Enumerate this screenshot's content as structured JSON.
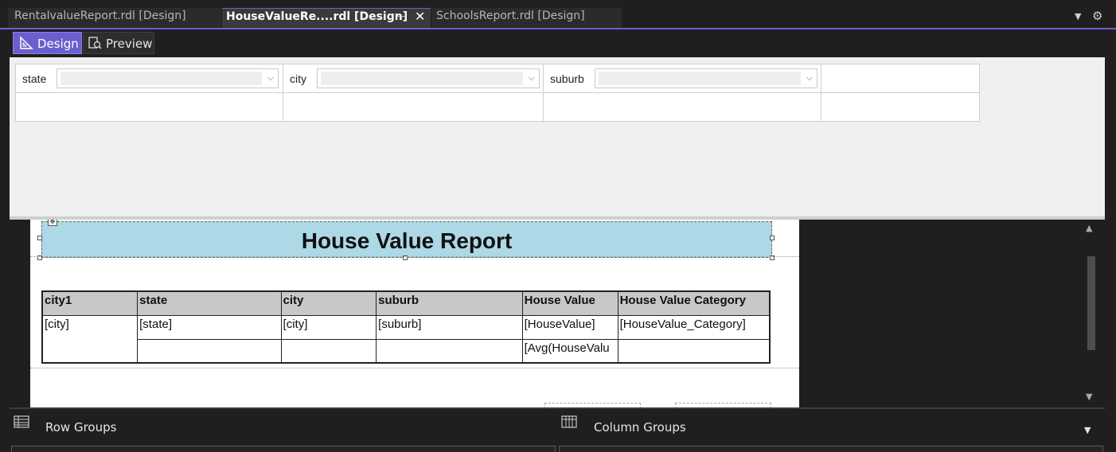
{
  "tabs": [
    {
      "label": "RentalvalueReport.rdl [Design]"
    },
    {
      "label": "HouseValueRe....rdl [Design]"
    },
    {
      "label": "SchoolsReport.rdl [Design]"
    }
  ],
  "tab_icons": {
    "pin": "pin-icon",
    "close": "close-icon",
    "overflow": "chevron-down-icon",
    "settings": "gear-icon"
  },
  "viewbar": {
    "design_label": "Design",
    "preview_label": "Preview"
  },
  "parameters": [
    {
      "label": "state",
      "value": ""
    },
    {
      "label": "city",
      "value": ""
    },
    {
      "label": "suburb",
      "value": ""
    }
  ],
  "report": {
    "title": "House Value Report",
    "title_background": "#add8e6",
    "table": {
      "headers": [
        "city1",
        "state",
        "city",
        "suburb",
        "House Value",
        "House Value Category"
      ],
      "detail_row": [
        "[city]",
        "[state]",
        "[city]",
        "[suburb]",
        "[HouseValue]",
        "[HouseValue_Category]"
      ],
      "total_row": [
        "",
        "",
        "",
        "",
        "[Avg(HouseValu",
        ""
      ]
    }
  },
  "grouping": {
    "row_groups_label": "Row Groups",
    "column_groups_label": "Column Groups"
  },
  "colors": {
    "accent": "#6b5fd0",
    "header_fill": "#c8c8c8",
    "surface": "#1f1f1f"
  }
}
